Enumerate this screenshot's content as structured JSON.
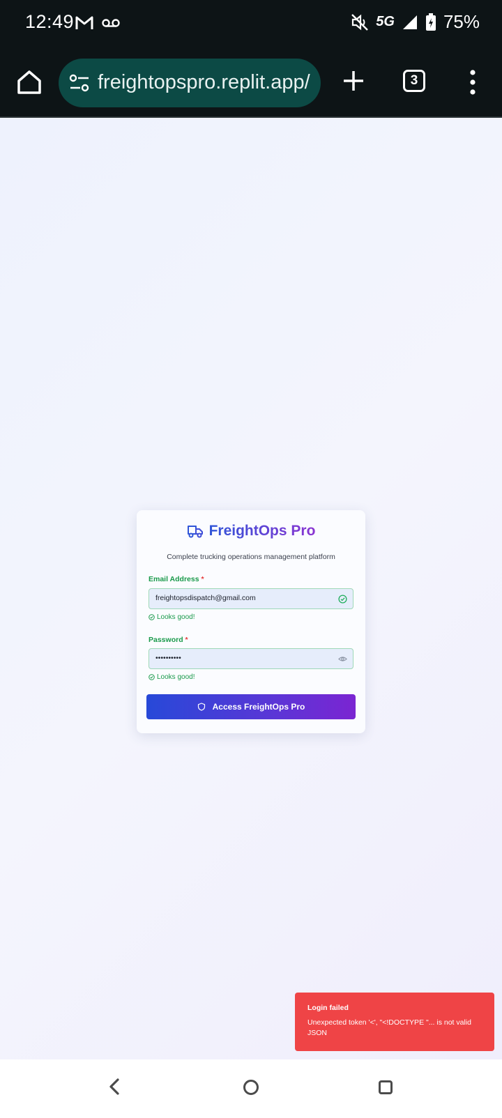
{
  "status_bar": {
    "time": "12:49",
    "network": "5G",
    "battery": "75%",
    "icons": [
      "gmail-icon",
      "voicemail-icon",
      "mute-icon",
      "signal-icon",
      "battery-charging-icon"
    ]
  },
  "browser": {
    "url": "freightopspro.replit.app/",
    "tab_count": "3"
  },
  "login": {
    "brand_title": "FreightOps Pro",
    "subtitle": "Complete trucking operations management platform",
    "email_label": "Email Address",
    "email_value": "freightopsdispatch@gmail.com",
    "password_label": "Password",
    "password_value": "••••••••••",
    "required_mark": "*",
    "valid_hint": "Looks good!",
    "submit_label": "Access FreightOps Pro"
  },
  "toast": {
    "title": "Login failed",
    "message": "Unexpected token '<', \"<!DOCTYPE \"... is not valid JSON"
  },
  "colors": {
    "accent_start": "#2749d8",
    "accent_end": "#7b25d2",
    "success": "#1a9a4b",
    "error": "#ef4446"
  }
}
